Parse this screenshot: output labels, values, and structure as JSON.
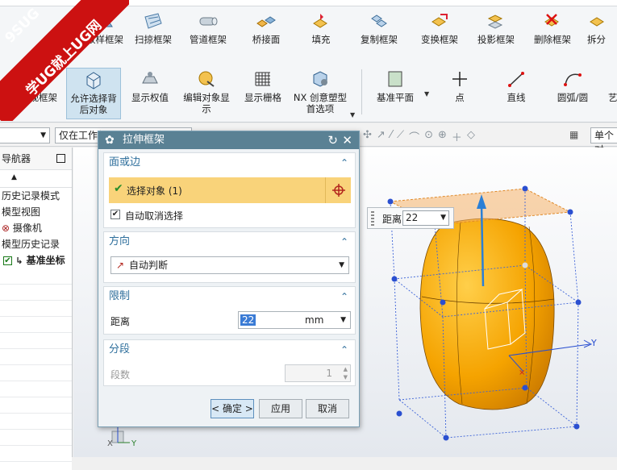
{
  "ribbon": {
    "row1": [
      {
        "label": "放样框架",
        "icon": "swept-frame-icon",
        "name": "ribbon-loft-frame"
      },
      {
        "label": "扫掠框架",
        "icon": "sweep-frame-icon",
        "name": "ribbon-sweep-frame"
      },
      {
        "label": "管道框架",
        "icon": "tube-frame-icon",
        "name": "ribbon-tube-frame"
      },
      {
        "label": "桥接面",
        "icon": "bridge-face-icon",
        "name": "ribbon-bridge-face"
      },
      {
        "label": "填充",
        "icon": "fill-icon",
        "name": "ribbon-fill"
      },
      {
        "label": "复制框架",
        "icon": "copy-frame-icon",
        "name": "ribbon-copy-frame"
      },
      {
        "label": "变换框架",
        "icon": "transform-frame-icon",
        "name": "ribbon-transform-frame"
      },
      {
        "label": "投影框架",
        "icon": "project-frame-icon",
        "name": "ribbon-project-frame"
      },
      {
        "label": "删除框架",
        "icon": "delete-frame-icon",
        "name": "ribbon-delete-frame"
      },
      {
        "label": "拆分",
        "icon": "split-icon",
        "name": "ribbon-split"
      }
    ],
    "row2": [
      {
        "label": "透视框架",
        "icon": "see-through-icon",
        "name": "ribbon-see-through"
      },
      {
        "label": "允许选择背",
        "label2": "后对象",
        "icon": "allow-back-select-icon",
        "name": "ribbon-allow-back-select"
      },
      {
        "label": "显示权值",
        "icon": "show-weight-icon",
        "name": "ribbon-show-weight"
      },
      {
        "label": "编辑对象显",
        "label2": "示",
        "icon": "edit-display-icon",
        "name": "ribbon-edit-display"
      },
      {
        "label": "显示栅格",
        "icon": "grid-icon",
        "name": "ribbon-show-grid"
      },
      {
        "label": "NX 创意塑型",
        "label2": "首选项",
        "icon": "nx-realize-prefs-icon",
        "name": "ribbon-nx-prefs"
      },
      {
        "label": "基准平面",
        "icon": "datum-plane-icon",
        "name": "ribbon-datum-plane"
      },
      {
        "label": "点",
        "icon": "point-icon",
        "name": "ribbon-point"
      },
      {
        "label": "直线",
        "icon": "line-icon",
        "name": "ribbon-line"
      },
      {
        "label": "圆弧/圆",
        "icon": "arc-icon",
        "name": "ribbon-arc"
      },
      {
        "label": "艺",
        "icon": "studio-spline-icon",
        "name": "ribbon-studio-spline"
      }
    ]
  },
  "selection_bar": {
    "filter_value": "",
    "scope_value": "仅在工作部",
    "right_value": "单个对"
  },
  "navigator": {
    "title": "导航器",
    "items": [
      "历史记录模式",
      "模型视图",
      "摄像机",
      "模型历史记录",
      "基准坐标"
    ]
  },
  "dialog": {
    "title": "拉伸框架",
    "group_face": {
      "header": "面或边",
      "select_label": "选择对象 (1)",
      "auto_deselect": "自动取消选择"
    },
    "group_direction": {
      "header": "方向",
      "value": "自动判断"
    },
    "group_limit": {
      "header": "限制",
      "distance_label": "距离",
      "distance_value": "22",
      "unit": "mm"
    },
    "group_segment": {
      "header": "分段",
      "count_label": "段数",
      "count_value": "1"
    },
    "ok": "< 确定 >",
    "apply": "应用",
    "cancel": "取消"
  },
  "distance_popup": {
    "label": "距离",
    "value": "22"
  },
  "watermark": {
    "line1": "9SUG",
    "line2": "学UG就上UG网"
  },
  "colors": {
    "dialog_title": "#5a8194",
    "selection_highlight": "#f9d37a",
    "model_orange": "#f5a300",
    "handle_blue": "#2a4fd0"
  }
}
